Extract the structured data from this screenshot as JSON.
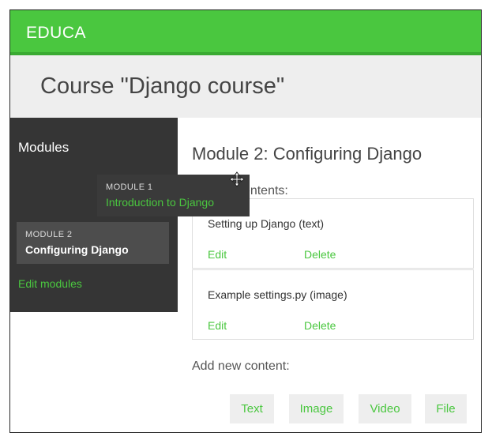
{
  "app": {
    "brand": "EDUCA"
  },
  "course": {
    "title": "Course \"Django course\""
  },
  "sidebar": {
    "heading": "Modules",
    "modules": [
      {
        "number": "MODULE 1",
        "title": "Introduction to Django",
        "dragging": true
      },
      {
        "number": "MODULE 2",
        "title": "Configuring Django",
        "selected": true
      }
    ],
    "edit_modules_label": "Edit modules"
  },
  "main": {
    "module_title": "Module 2: Configuring Django",
    "contents_label": "Module contents:",
    "contents": [
      {
        "title": "Setting up Django (text)",
        "edit_label": "Edit",
        "delete_label": "Delete"
      },
      {
        "title": "Example settings.py (image)",
        "edit_label": "Edit",
        "delete_label": "Delete"
      }
    ],
    "add_label": "Add new content:",
    "add_buttons": [
      "Text",
      "Image",
      "Video",
      "File"
    ]
  },
  "icons": {
    "cursor": "move-cursor-icon"
  },
  "colors": {
    "accent": "#4ac73f",
    "sidebar": "#353535",
    "header": "#eeeeee"
  }
}
